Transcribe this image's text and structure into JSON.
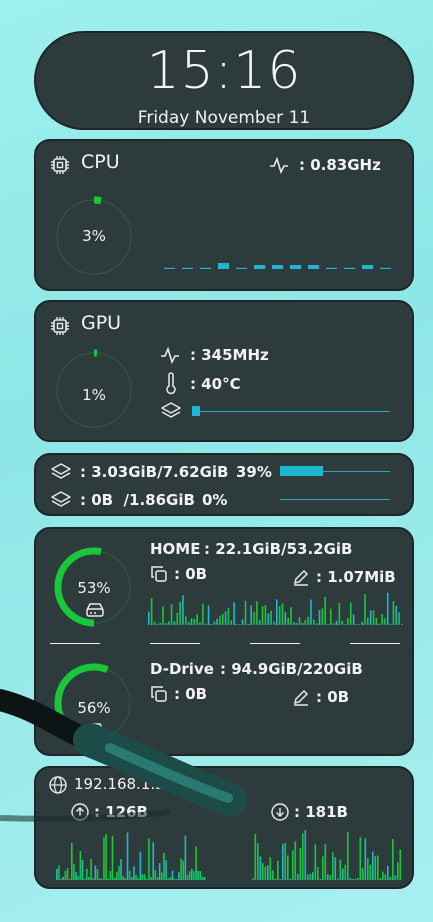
{
  "clock": {
    "time": "15:16",
    "date": "Friday November 11"
  },
  "cpu": {
    "title": "CPU",
    "freq": ": 0.83GHz",
    "usage": "3%",
    "usage_frac": 0.03,
    "bars": [
      0.05,
      0.05,
      0.05,
      0.3,
      0.05,
      0.2,
      0.2,
      0.2,
      0.2,
      0.05,
      0.05,
      0.2,
      0.05
    ]
  },
  "gpu": {
    "title": "GPU",
    "freq": ": 345MHz",
    "temp": ": 40°C",
    "usage": "1%",
    "usage_frac": 0.01,
    "vram_frac": 0.04
  },
  "memory": {
    "ram": {
      "text": ": 3.03GiB/7.62GiB",
      "pct": "39%",
      "frac": 0.39
    },
    "swap": {
      "text": ": 0B  /1.86GiB",
      "pct": "0%",
      "frac": 0.0
    }
  },
  "disks": [
    {
      "name": "HOME",
      "size": ": 22.1GiB/53.2GiB",
      "read": ": 0B",
      "write": ": 1.07MiB",
      "usage": "53%",
      "usage_frac": 0.53
    },
    {
      "name": "D-Drive",
      "size": ": 94.9GiB/220GiB",
      "read": ": 0B",
      "write": ": 0B",
      "usage": "56%",
      "usage_frac": 0.56
    }
  ],
  "network": {
    "ip": "192.168.1.3",
    "upload": ": 126B",
    "download": ": 181B"
  },
  "colors": {
    "accent": "#1fb6cf",
    "ring": "#18c83a",
    "panel": "#2e3b3c"
  }
}
